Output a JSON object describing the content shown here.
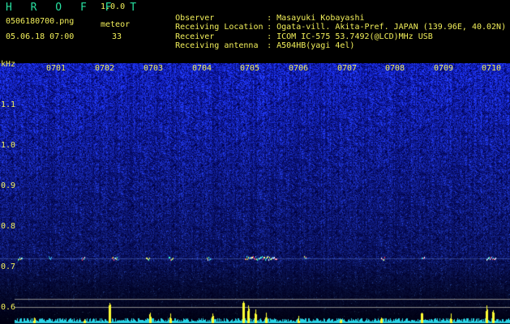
{
  "header": {
    "app_name": "H R O F F T",
    "version": "1.0.0",
    "file_name": "0506180700.png",
    "datetime": "05.06.18 07:00",
    "meteor_label": "meteor",
    "meteor_count": "33"
  },
  "station_info": [
    {
      "label": "Observer",
      "sep": ":",
      "value": "Masayuki Kobayashi"
    },
    {
      "label": "Receiving Location",
      "sep": ":",
      "value": "Ogata-vill. Akita-Pref. JAPAN (139.96E, 40.02N)"
    },
    {
      "label": "Receiver",
      "sep": ":",
      "value": "ICOM IC-575 53.7492(@LCD)MHz USB"
    },
    {
      "label": "Receiving antenna",
      "sep": ":",
      "value": "A504HB(yagi 4el)"
    }
  ],
  "chart_data": {
    "type": "heatmap",
    "ylabel": "kHz",
    "y_ticks": [
      "1.1",
      "1.0",
      "0.9",
      "0.8",
      "0.7",
      "0.6"
    ],
    "x_ticks": [
      "0701",
      "0702",
      "0703",
      "0704",
      "0705",
      "0706",
      "0707",
      "0708",
      "0709",
      "0710"
    ],
    "ylim": [
      0.6,
      1.15
    ],
    "xlim": [
      0,
      10
    ]
  },
  "colors": {
    "background": "#000000",
    "text_yellow": "#f2ef5a",
    "title_green": "#27e0a0",
    "spectrum_blue": "#1a3cb0",
    "meteor_yellow": "#ffff33",
    "noise_cyan": "#2ad4e6",
    "line_gray": "#8a8a8a"
  }
}
